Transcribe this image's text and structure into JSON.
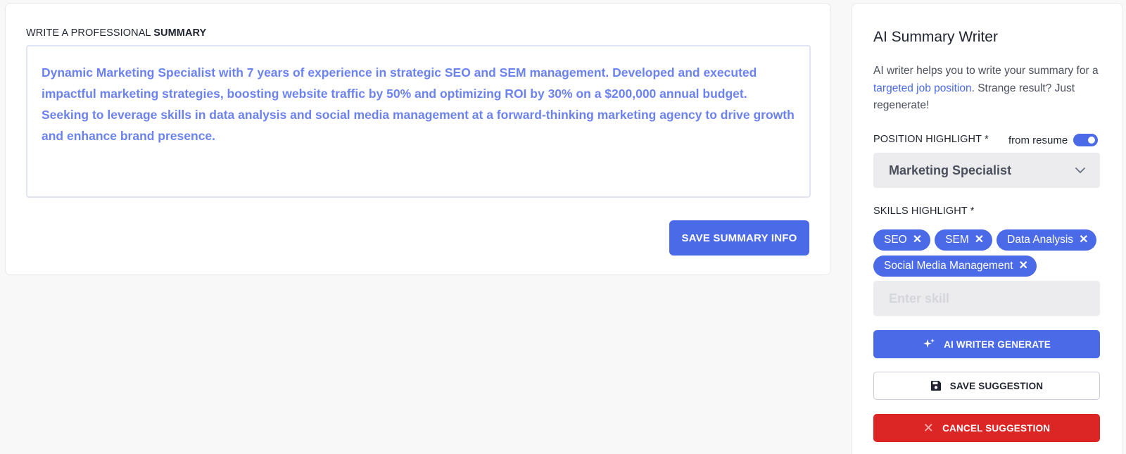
{
  "summary_section": {
    "label_prefix": "WRITE A PROFESSIONAL ",
    "label_bold": "SUMMARY",
    "summary_text": "Dynamic Marketing Specialist with 7 years of experience in strategic SEO and SEM management. Developed and executed impactful marketing strategies, boosting website traffic by 50% and optimizing ROI by 30% on a $200,000 annual budget. Seeking to leverage skills in data analysis and social media management at a forward-thinking marketing agency to drive growth and enhance brand presence.",
    "save_button": "SAVE SUMMARY INFO"
  },
  "ai_panel": {
    "title": "AI Summary Writer",
    "desc_before": "AI writer helps you to write your summary for a ",
    "desc_link": "targeted job position",
    "desc_after": ". Strange result? Just regenerate!",
    "position_label": "POSITION HIGHLIGHT",
    "required_mark": "*",
    "toggle_label": "from resume",
    "toggle_on": true,
    "position_value": "Marketing Specialist",
    "skills_label": "SKILLS HIGHLIGHT",
    "skills": [
      {
        "label": "SEO"
      },
      {
        "label": "SEM"
      },
      {
        "label": "Data Analysis"
      },
      {
        "label": "Social Media Management"
      }
    ],
    "skill_placeholder": "Enter skill",
    "generate_button": "AI WRITER GENERATE",
    "save_suggestion_button": "SAVE SUGGESTION",
    "cancel_suggestion_button": "CANCEL SUGGESTION"
  },
  "icons": {
    "chip_remove": "close-icon",
    "generate": "sparkle-icon",
    "save": "floppy-disk-icon",
    "cancel": "close-icon",
    "select": "chevron-down-icon"
  },
  "colors": {
    "accent": "#4a6ae8",
    "summary_text": "#6b82ef",
    "danger": "#dc2626"
  }
}
